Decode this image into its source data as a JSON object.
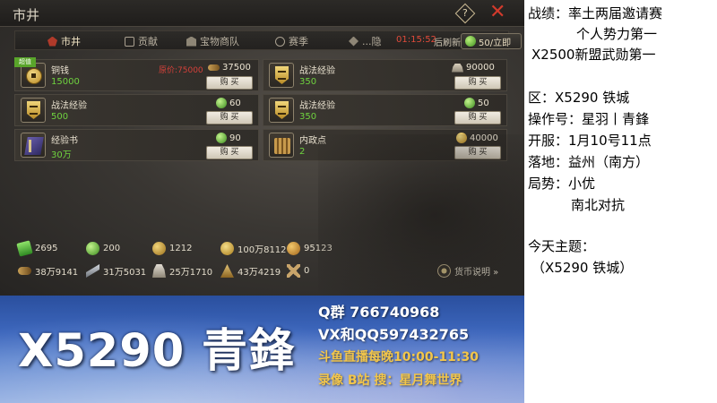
{
  "window": {
    "title": "市井",
    "help_symbol": "?",
    "close_symbol": "✕"
  },
  "tabs": [
    {
      "label": "市井"
    },
    {
      "label": "贡献"
    },
    {
      "label": "宝物商队"
    },
    {
      "label": "赛季"
    },
    {
      "label": "...隐"
    }
  ],
  "refresh": {
    "countdown": "01:15:52",
    "label": "后刷新",
    "cost_label": "50/立即"
  },
  "sale_tag": "超值",
  "items": [
    {
      "name": "铜钱",
      "amount": "15000",
      "original_price": "原价:75000",
      "price": "37500",
      "icon": "copper-coin-icon",
      "price_icon": "ingot-icon",
      "buy": "购 买"
    },
    {
      "name": "战法经验",
      "amount": "350",
      "original_price": "",
      "price": "90000",
      "icon": "war-exp-medal-icon",
      "price_icon": "ingot-icon",
      "buy": "购 买"
    },
    {
      "name": "战法经验",
      "amount": "500",
      "original_price": "",
      "price": "60",
      "icon": "war-exp-medal-icon",
      "price_icon": "jade-icon",
      "buy": "购 买"
    },
    {
      "name": "战法经验",
      "amount": "350",
      "original_price": "",
      "price": "50",
      "icon": "war-exp-medal-icon",
      "price_icon": "jade-icon",
      "buy": "购 买"
    },
    {
      "name": "经验书",
      "amount": "30万",
      "original_price": "",
      "price": "90",
      "icon": "exp-book-icon",
      "price_icon": "jade-icon",
      "buy": "购 买"
    },
    {
      "name": "内政点",
      "amount": "2",
      "original_price": "",
      "price": "40000",
      "icon": "admin-scroll-icon",
      "price_icon": "gold-coin-icon",
      "buy": "购 买"
    }
  ],
  "currencies_row1": [
    {
      "value": "2695",
      "icon": "banknote-icon"
    },
    {
      "value": "200",
      "icon": "jade-icon"
    },
    {
      "value": "1212",
      "icon": "medal-icon"
    },
    {
      "value": "100万8112",
      "icon": "copper-coin-icon"
    },
    {
      "value": "95123",
      "icon": "grain-icon"
    }
  ],
  "currencies_row2": [
    {
      "value": "38万9141",
      "icon": "wood-icon"
    },
    {
      "value": "31万5031",
      "icon": "iron-icon"
    },
    {
      "value": "25万1710",
      "icon": "stone-icon"
    },
    {
      "value": "43万4219",
      "icon": "wheat-icon"
    },
    {
      "value": "0",
      "icon": "crossed-swords-icon"
    }
  ],
  "currency_help": "货币说明 »",
  "banner": {
    "title": "X5290 青鋒",
    "qq": "Q群 766740968",
    "vx": "VX和QQ597432765",
    "douyu": "斗鱼直播每晚10:00-11:30",
    "bilibili": "录像 B站 搜：星月舞世界"
  },
  "info": [
    "战绩：率土两届邀请赛",
    "个人势力第一",
    "X2500新盟武勋第一",
    "区：X5290 铁城",
    "操作号：星羽丨青鋒",
    "开服：1月10号11点",
    "落地：益州（南方）",
    "局势：小优",
    "南北对抗",
    "今天主题：",
    "（X5290 铁城）"
  ]
}
